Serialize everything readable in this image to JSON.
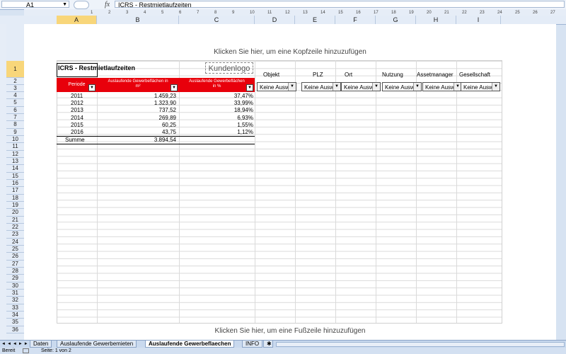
{
  "formula_bar": {
    "name_box": "A1",
    "fx": "fx",
    "formula": "ICRS - Restmietlaufzeiten"
  },
  "ruler_ticks": [
    "1",
    "2",
    "3",
    "4",
    "5",
    "6",
    "7",
    "8",
    "9",
    "10",
    "11",
    "12",
    "13",
    "14",
    "15",
    "16",
    "17",
    "18",
    "19",
    "20",
    "21",
    "22",
    "23",
    "24",
    "25",
    "26",
    "27"
  ],
  "columns": [
    "A",
    "B",
    "C",
    "D",
    "E",
    "F",
    "G",
    "H",
    "I"
  ],
  "rows": [
    "1",
    "2",
    "3",
    "4",
    "5",
    "6",
    "7",
    "8",
    "9",
    "10",
    "11",
    "12",
    "13",
    "14",
    "15",
    "16",
    "17",
    "18",
    "19",
    "20",
    "21",
    "22",
    "23",
    "24",
    "25",
    "26",
    "27",
    "28",
    "29",
    "30",
    "31",
    "32",
    "33",
    "34",
    "35",
    "36"
  ],
  "page": {
    "header_placeholder": "Klicken Sie hier, um eine Kopfzeile hinzuzufügen",
    "footer_placeholder": "Klicken Sie hier, um eine Fußzeile hinzuzufügen",
    "title": "ICRS - Restmietlaufzeiten",
    "logo": "Kundenlogo"
  },
  "filters": [
    {
      "label": "Objekt",
      "value": "Keine Auswahl"
    },
    {
      "label": "PLZ",
      "value": "Keine Auswahl"
    },
    {
      "label": "Ort",
      "value": "Keine Auswahl"
    },
    {
      "label": "Nutzung",
      "value": "Keine Auswahl"
    },
    {
      "label": "Assetmanager",
      "value": "Keine Auswahl"
    },
    {
      "label": "Gesellschaft",
      "value": "Keine Auswahl"
    }
  ],
  "table": {
    "headers": {
      "periode": "Periode",
      "col_b": "Auslaufende Gewerbeflächen in m²",
      "col_c": "Auslaufende Gewerbeflächen in %"
    },
    "rows": [
      {
        "periode": "2011",
        "area": "1.459,23",
        "percent": "37,47%"
      },
      {
        "periode": "2012",
        "area": "1.323,90",
        "percent": "33,99%"
      },
      {
        "periode": "2013",
        "area": "737,52",
        "percent": "18,94%"
      },
      {
        "periode": "2014",
        "area": "269,89",
        "percent": "6,93%"
      },
      {
        "periode": "2015",
        "area": "60,25",
        "percent": "1,55%"
      },
      {
        "periode": "2016",
        "area": "43,75",
        "percent": "1,12%"
      }
    ],
    "sum": {
      "label": "Summe",
      "area": "3.894,54"
    }
  },
  "sheet_tabs": [
    "Daten",
    "Auslaufende Gewerbemieten",
    "Auslaufende Gewerbeflaechen",
    "INFO"
  ],
  "active_sheet": "Auslaufende Gewerbeflaechen",
  "status": {
    "ready": "Bereit",
    "page": "Seite: 1 von 2"
  }
}
